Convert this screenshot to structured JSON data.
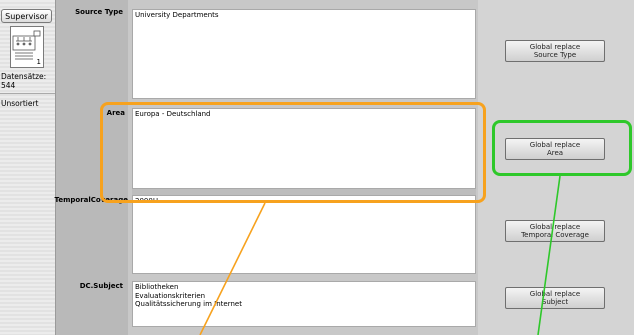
{
  "sidebar": {
    "supervisor_label": "Supervisor",
    "record_number": "1",
    "records_label": "Datensätze:",
    "records_count": "544",
    "sort_status": "Unsortiert"
  },
  "fields": {
    "source_type": {
      "label": "Source Type",
      "lines": [
        "University Departments"
      ]
    },
    "area": {
      "label": "Area",
      "lines": [
        "Europa - Deutschland"
      ]
    },
    "temporal": {
      "label": "TemporalCoverage",
      "lines": [
        "2000H"
      ]
    },
    "subject": {
      "label": "DC.Subject",
      "lines": [
        "Bibliotheken",
        "Evaluationskriterien",
        "Qualitätssicherung im Internet"
      ]
    }
  },
  "buttons": {
    "source_type": [
      "Global replace",
      "Source Type"
    ],
    "area": [
      "Global replace",
      "Area"
    ],
    "temporal": [
      "Global replace",
      "Temporal Coverage"
    ],
    "subject": [
      "Global replace",
      "Subject"
    ]
  },
  "annotations": {
    "orange": "#f7a21e",
    "green": "#2ec82a"
  }
}
